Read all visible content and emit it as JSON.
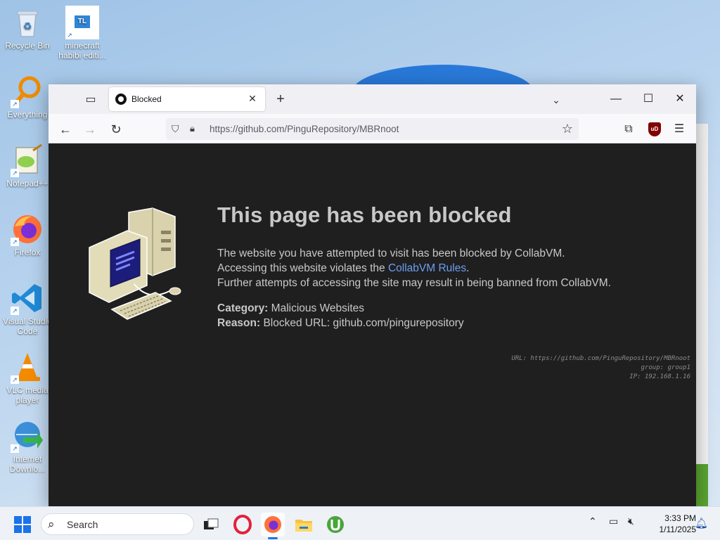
{
  "desktop": {
    "icons": [
      {
        "label": "Recycle Bin",
        "icon": "recycle-bin-icon"
      },
      {
        "label": "minecraft habibi editi...",
        "icon": "tlauncher-icon",
        "badge": "TL"
      },
      {
        "label": "Everything",
        "icon": "everything-search-icon"
      },
      {
        "label": "Notepad++",
        "icon": "notepadpp-icon"
      },
      {
        "label": "Firefox",
        "icon": "firefox-icon"
      },
      {
        "label": "Visual Studio Code",
        "icon": "vscode-icon"
      },
      {
        "label": "VLC media player",
        "icon": "vlc-icon"
      },
      {
        "label": "Internet Downlo...",
        "icon": "idm-icon"
      }
    ]
  },
  "browser": {
    "tab": {
      "title": "Blocked",
      "favicon": "github-icon"
    },
    "url": "https://github.com/PinguRepository/MBRnoot",
    "window_controls": {
      "minimize": "—",
      "maximize": "☐",
      "close": "✕"
    },
    "extension_label": "uD"
  },
  "blocked_page": {
    "title": "This page has been blocked",
    "line1": "The website you have attempted to visit has been blocked by CollabVM.",
    "line2_prefix": "Accessing this website violates the ",
    "line2_link": "CollabVM Rules",
    "line2_suffix": ".",
    "line3": "Further attempts of accessing the site may result in being banned from CollabVM.",
    "category_label": "Category:",
    "category_value": " Malicious Websites",
    "reason_label": "Reason:",
    "reason_value": " Blocked URL: github.com/pingurepository",
    "debug": {
      "url_line": "URL: https://github.com/PinguRepository/MBRnoot",
      "group_line": "group: group1",
      "ip_line": "IP: 192.168.1.16"
    },
    "link_color": "#6c9ef0",
    "text_color": "#c8c8c8",
    "background": "#1f1f1f"
  },
  "taskbar": {
    "search_placeholder": "Search",
    "apps": [
      "task-view-icon",
      "opera-icon",
      "firefox-icon",
      "file-explorer-icon",
      "utorrent-icon"
    ],
    "time": "3:33 PM",
    "date": "1/11/2025"
  }
}
